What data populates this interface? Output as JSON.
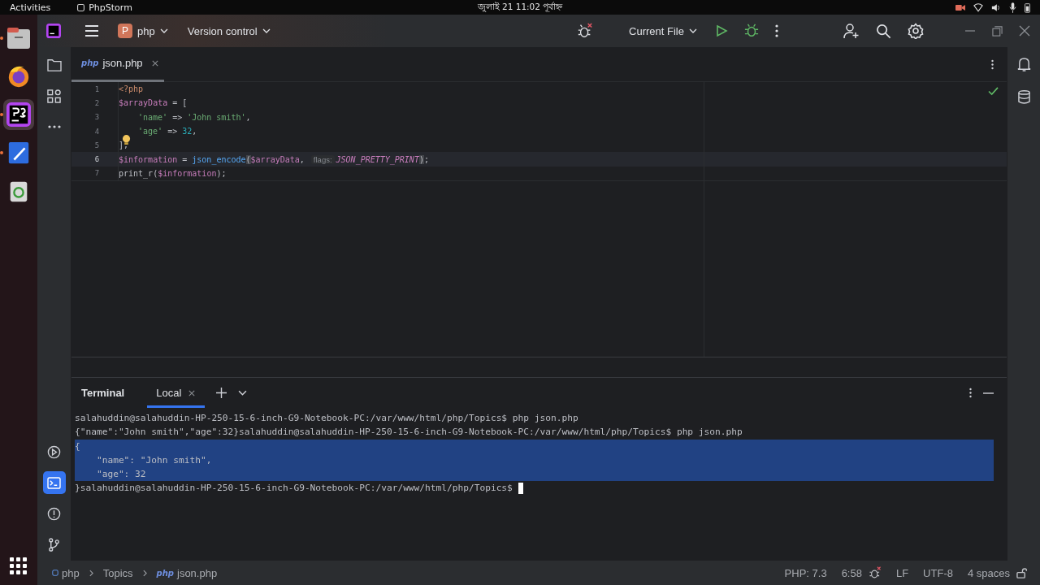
{
  "topbar": {
    "activities": "Activities",
    "app": "PhpStorm",
    "clock": "জুলাই 21  11:02 পূর্বাহ্ন"
  },
  "dock": [
    {
      "kind": "files",
      "running": true,
      "selected": false
    },
    {
      "kind": "firefox",
      "running": false,
      "selected": false
    },
    {
      "kind": "phpstorm",
      "running": true,
      "selected": true
    },
    {
      "kind": "editor",
      "running": true,
      "selected": false
    },
    {
      "kind": "trash",
      "running": false,
      "selected": false
    }
  ],
  "toolbar": {
    "project_badge": "P",
    "project": "php",
    "vcs": "Version control",
    "run_config": "Current File"
  },
  "tool_strip_top": [
    {
      "kind": "folder",
      "selected": false
    },
    {
      "kind": "structure",
      "selected": false
    },
    {
      "kind": "more",
      "selected": false
    }
  ],
  "tool_strip_bottom": [
    {
      "kind": "run",
      "selected": false
    },
    {
      "kind": "terminal",
      "selected": true
    },
    {
      "kind": "problems",
      "selected": false
    },
    {
      "kind": "git",
      "selected": false
    }
  ],
  "editor_tab": {
    "file_type": "php",
    "label": "json.php",
    "selected": true
  },
  "code": [
    {
      "number": "1",
      "current": false,
      "tokens": [
        {
          "kind": "tag",
          "text": "<?php"
        }
      ]
    },
    {
      "number": "2",
      "current": false,
      "tokens": [
        {
          "kind": "var",
          "text": "$arrayData"
        },
        {
          "kind": "op",
          "text": " = ["
        }
      ]
    },
    {
      "number": "3",
      "current": false,
      "tokens": [
        {
          "kind": "indent"
        },
        {
          "kind": "str",
          "text": "'name'"
        },
        {
          "kind": "op",
          "text": " => "
        },
        {
          "kind": "str",
          "text": "'John smith'"
        },
        {
          "kind": "op",
          "text": ","
        }
      ]
    },
    {
      "number": "4",
      "current": false,
      "tokens": [
        {
          "kind": "indent"
        },
        {
          "kind": "str",
          "text": "'age'"
        },
        {
          "kind": "op",
          "text": " => "
        },
        {
          "kind": "num",
          "text": "32"
        },
        {
          "kind": "op",
          "text": ","
        }
      ]
    },
    {
      "number": "5",
      "current": false,
      "tokens": [
        {
          "kind": "op",
          "text": "];"
        },
        {
          "kind": "bulb"
        }
      ]
    },
    {
      "number": "6",
      "current": true,
      "tokens": [
        {
          "kind": "var",
          "text": "$information"
        },
        {
          "kind": "op",
          "text": " = "
        },
        {
          "kind": "fn",
          "text": "json_encode"
        },
        {
          "kind": "match",
          "text": "("
        },
        {
          "kind": "var",
          "text": "$arrayData"
        },
        {
          "kind": "op",
          "text": ", "
        },
        {
          "kind": "hint",
          "text": "flags:"
        },
        {
          "kind": "const",
          "text": "JSON_PRETTY_PRINT"
        },
        {
          "kind": "match",
          "text": ")"
        },
        {
          "kind": "op",
          "text": ";"
        }
      ]
    },
    {
      "number": "7",
      "current": false,
      "tokens": [
        {
          "kind": "fn2",
          "text": "print_r"
        },
        {
          "kind": "op",
          "text": "("
        },
        {
          "kind": "var",
          "text": "$information"
        },
        {
          "kind": "op",
          "text": ");"
        }
      ]
    }
  ],
  "terminal": {
    "title": "Terminal",
    "tabs": [
      {
        "label": "Local",
        "selected": true
      }
    ],
    "lines": [
      {
        "text": "salahuddin@salahuddin-HP-250-15-6-inch-G9-Notebook-PC:/var/www/html/php/Topics$ php json.php",
        "selected": false
      },
      {
        "text": "{\"name\":\"John smith\",\"age\":32}salahuddin@salahuddin-HP-250-15-6-inch-G9-Notebook-PC:/var/www/html/php/Topics$ php json.php",
        "selected": false
      },
      {
        "text": "{",
        "selected": true
      },
      {
        "text": "    \"name\": \"John smith\",",
        "selected": true
      },
      {
        "text": "    \"age\": 32",
        "selected": true
      },
      {
        "text": "}salahuddin@salahuddin-HP-250-15-6-inch-G9-Notebook-PC:/var/www/html/php/Topics$",
        "selected": false,
        "cursor": true
      }
    ]
  },
  "breadcrumbs": [
    {
      "kind": "module",
      "label": "php"
    },
    {
      "kind": "folder",
      "label": "Topics"
    },
    {
      "kind": "php",
      "label": "json.php"
    }
  ],
  "status": {
    "php_version": "PHP: 7.3",
    "position": "6:58",
    "line_separator": "LF",
    "encoding": "UTF-8",
    "indent": "4 spaces"
  }
}
